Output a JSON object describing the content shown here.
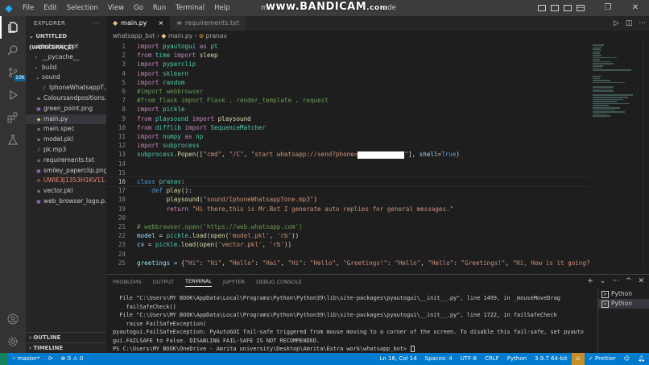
{
  "titlebar": {
    "menu": [
      "File",
      "Edit",
      "Selection",
      "View",
      "Go",
      "Run",
      "Terminal",
      "Help"
    ],
    "title_prefix": "m",
    "watermark": "www.BANDICAM",
    "watermark_sub": ".com",
    "title_suffix": "ode"
  },
  "activity": {
    "source_control_badge": "10K"
  },
  "sidebar": {
    "header": "EXPLORER",
    "workspace": "UNTITLED (WORKSPACE)",
    "items": [
      {
        "label": "whatsapp_bot",
        "kind": "folder-open",
        "indent": 1
      },
      {
        "label": "__pycache__",
        "kind": "folder",
        "indent": 2
      },
      {
        "label": "build",
        "kind": "folder",
        "indent": 2
      },
      {
        "label": "sound",
        "kind": "folder-open",
        "indent": 2
      },
      {
        "label": "IphoneWhatsappT...",
        "kind": "audio",
        "indent": 3
      },
      {
        "label": "Coloursandpositions...",
        "kind": "file",
        "indent": 2
      },
      {
        "label": "green_point.png",
        "kind": "image",
        "indent": 2
      },
      {
        "label": "main.py",
        "kind": "python",
        "indent": 2,
        "selected": true
      },
      {
        "label": "main.spec",
        "kind": "file",
        "indent": 2
      },
      {
        "label": "model.pkl",
        "kind": "file",
        "indent": 2
      },
      {
        "label": "pk.mp3",
        "kind": "audio",
        "indent": 2
      },
      {
        "label": "requirements.txt",
        "kind": "text",
        "indent": 2
      },
      {
        "label": "smiley_paperclip.png",
        "kind": "image",
        "indent": 2
      },
      {
        "label": "UWIE3J1353H1KV11...",
        "kind": "error",
        "indent": 2
      },
      {
        "label": "vector.pkl",
        "kind": "file",
        "indent": 2
      },
      {
        "label": "web_browser_logo.p...",
        "kind": "image",
        "indent": 2
      }
    ],
    "footer": [
      "OUTLINE",
      "TIMELINE"
    ]
  },
  "tabs": [
    {
      "label": "main.py",
      "active": true,
      "close": "×"
    },
    {
      "label": "requirements.txt",
      "active": false
    }
  ],
  "breadcrumb": [
    "whatsapp_bot",
    "main.py",
    "pranav"
  ],
  "editor": {
    "current_line": 16,
    "lines": [
      {
        "n": "1",
        "t": [
          [
            "kw",
            "import "
          ],
          [
            "mod",
            "pyautogui"
          ],
          [
            "kw",
            " as "
          ],
          [
            "mod",
            "pt"
          ]
        ]
      },
      {
        "n": "2",
        "t": [
          [
            "kw",
            "from "
          ],
          [
            "mod",
            "time"
          ],
          [
            "kw",
            " import "
          ],
          [
            "fn",
            "sleep"
          ]
        ]
      },
      {
        "n": "3",
        "t": [
          [
            "kw",
            "import "
          ],
          [
            "mod",
            "pyperclip"
          ]
        ]
      },
      {
        "n": "4",
        "t": [
          [
            "kw",
            "import "
          ],
          [
            "mod",
            "sklearn"
          ]
        ]
      },
      {
        "n": "5",
        "t": [
          [
            "kw",
            "import "
          ],
          [
            "mod",
            "random"
          ]
        ]
      },
      {
        "n": "6",
        "t": [
          [
            "cmt",
            "#import webbrowser"
          ]
        ]
      },
      {
        "n": "7",
        "t": [
          [
            "cmt",
            "#from flask import Flask , render_template , request"
          ]
        ]
      },
      {
        "n": "8",
        "t": [
          [
            "kw",
            "import "
          ],
          [
            "mod",
            "pickle"
          ]
        ]
      },
      {
        "n": "9",
        "t": [
          [
            "kw",
            "from "
          ],
          [
            "mod",
            "playsound"
          ],
          [
            "kw",
            " import "
          ],
          [
            "fn",
            "playsound"
          ]
        ]
      },
      {
        "n": "10",
        "t": [
          [
            "kw",
            "from "
          ],
          [
            "mod",
            "difflib"
          ],
          [
            "kw",
            " import "
          ],
          [
            "mod",
            "SequenceMatcher"
          ]
        ]
      },
      {
        "n": "11",
        "t": [
          [
            "kw",
            "import "
          ],
          [
            "mod",
            "numpy"
          ],
          [
            "kw",
            " as "
          ],
          [
            "mod",
            "np"
          ]
        ]
      },
      {
        "n": "12",
        "t": [
          [
            "kw",
            "import "
          ],
          [
            "mod",
            "subprocess"
          ]
        ]
      },
      {
        "n": "13",
        "t": [
          [
            "mod",
            "subprocess"
          ],
          [
            "plain",
            "."
          ],
          [
            "fn",
            "Popen"
          ],
          [
            "plain",
            "(["
          ],
          [
            "str",
            "\"cmd\""
          ],
          [
            "plain",
            ", "
          ],
          [
            "str",
            "\"/C\""
          ],
          [
            "plain",
            ", "
          ],
          [
            "str",
            "\"start whatsapp://send?phone="
          ],
          [
            "redact",
            ""
          ],
          [
            "str",
            "\""
          ],
          [
            "plain",
            "], "
          ],
          [
            "var",
            "shell"
          ],
          [
            "plain",
            "="
          ],
          [
            "kw2",
            "True"
          ],
          [
            "plain",
            ")"
          ]
        ]
      },
      {
        "n": "14",
        "t": []
      },
      {
        "n": "15",
        "t": []
      },
      {
        "n": "16",
        "t": [
          [
            "kw2",
            "class "
          ],
          [
            "mod",
            "pranav"
          ],
          [
            "plain",
            ":"
          ]
        ]
      },
      {
        "n": "17",
        "t": [
          [
            "plain",
            "    "
          ],
          [
            "kw2",
            "def "
          ],
          [
            "fn",
            "play"
          ],
          [
            "plain",
            "():"
          ]
        ]
      },
      {
        "n": "18",
        "t": [
          [
            "plain",
            "        "
          ],
          [
            "fn",
            "playsound"
          ],
          [
            "plain",
            "("
          ],
          [
            "str",
            "\"sound/IphoneWhatsappTone.mp3\""
          ],
          [
            "plain",
            ")"
          ]
        ]
      },
      {
        "n": "19",
        "t": [
          [
            "plain",
            "        "
          ],
          [
            "kw",
            "return "
          ],
          [
            "str",
            "\"Hi there,this is Mr.Bot I generate auto replies for general messages.\""
          ]
        ]
      },
      {
        "n": "20",
        "t": []
      },
      {
        "n": "21",
        "t": [
          [
            "cmt",
            "# webbrowser.open('https://web.whatsapp.com')"
          ]
        ]
      },
      {
        "n": "22",
        "t": [
          [
            "var",
            "model"
          ],
          [
            "plain",
            " = "
          ],
          [
            "mod",
            "pickle"
          ],
          [
            "plain",
            "."
          ],
          [
            "fn",
            "load"
          ],
          [
            "plain",
            "("
          ],
          [
            "fn",
            "open"
          ],
          [
            "plain",
            "("
          ],
          [
            "str",
            "'model.pkl'"
          ],
          [
            "plain",
            ", "
          ],
          [
            "str",
            "'rb'"
          ],
          [
            "plain",
            "))"
          ]
        ]
      },
      {
        "n": "23",
        "t": [
          [
            "var",
            "cv"
          ],
          [
            "plain",
            " = "
          ],
          [
            "mod",
            "pickle"
          ],
          [
            "plain",
            "."
          ],
          [
            "fn",
            "load"
          ],
          [
            "plain",
            "("
          ],
          [
            "fn",
            "open"
          ],
          [
            "plain",
            "("
          ],
          [
            "str",
            "'vector.pkl'"
          ],
          [
            "plain",
            ", "
          ],
          [
            "str",
            "'rb'"
          ],
          [
            "plain",
            "))"
          ]
        ]
      },
      {
        "n": "24",
        "t": []
      },
      {
        "n": "25",
        "t": [
          [
            "var",
            "greetings"
          ],
          [
            "plain",
            " = {"
          ],
          [
            "str",
            "\"Hi\""
          ],
          [
            "plain",
            ": "
          ],
          [
            "str",
            "\"Hi\""
          ],
          [
            "plain",
            ", "
          ],
          [
            "str",
            "\"Hello\""
          ],
          [
            "plain",
            ": "
          ],
          [
            "str",
            "\"Hai\""
          ],
          [
            "plain",
            ", "
          ],
          [
            "str",
            "\"Hi\""
          ],
          [
            "plain",
            ": "
          ],
          [
            "str",
            "\"Hello\""
          ],
          [
            "plain",
            ", "
          ],
          [
            "str",
            "\"Greetings!\""
          ],
          [
            "plain",
            ": "
          ],
          [
            "str",
            "\"Hello\""
          ],
          [
            "plain",
            ", "
          ],
          [
            "str",
            "\"Hello\""
          ],
          [
            "plain",
            ": "
          ],
          [
            "str",
            "\"Greetings!\""
          ],
          [
            "plain",
            ", "
          ],
          [
            "str",
            "\"Hi, How is it going?"
          ]
        ]
      }
    ]
  },
  "panel": {
    "tabs": [
      "PROBLEMS",
      "OUTPUT",
      "TERMINAL",
      "JUPYTER",
      "DEBUG CONSOLE"
    ],
    "active_tab": "TERMINAL",
    "terminal_lines": [
      "  File \"C:\\Users\\MY BOOK\\AppData\\Local\\Programs\\Python\\Python39\\lib\\site-packages\\pyautogui\\__init__.py\", line 1499, in _mouseMoveDrag",
      "    failSafeCheck()",
      "  File \"C:\\Users\\MY BOOK\\AppData\\Local\\Programs\\Python\\Python39\\lib\\site-packages\\pyautogui\\__init__.py\", line 1722, in failSafeCheck",
      "    raise FailSafeException(",
      "pyautogui.FailSafeException: PyAutoGUI fail-safe triggered from mouse moving to a corner of the screen. To disable this fail-safe, set pyauto",
      "gui.FAILSAFE to False. DISABLING FAIL-SAFE IS NOT RECOMMENDED.",
      "PS C:\\Users\\MY BOOK\\OneDrive - Amrita university\\Desktop\\Amrita\\Extra work\\whatsapp_bot> "
    ],
    "terminals": [
      "Python",
      "Python"
    ]
  },
  "statusbar": {
    "branch": "master*",
    "sync": "⟳",
    "errors": "0",
    "warnings": "0",
    "position": "Ln 16, Col 14",
    "spaces": "Spaces: 4",
    "encoding": "UTF-8",
    "eol": "CRLF",
    "language": "Python",
    "interpreter": "3.9.7 64-bit",
    "prettier": "Prettier"
  }
}
